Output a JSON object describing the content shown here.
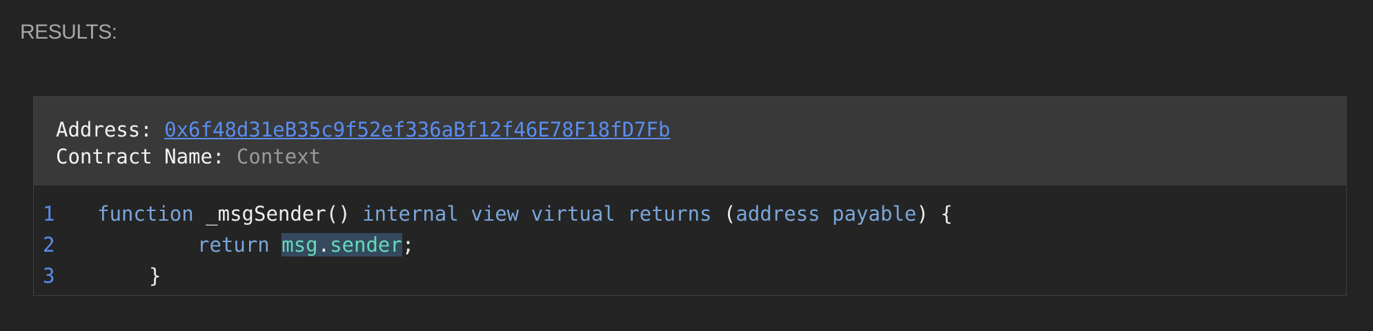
{
  "results": {
    "label": "RESULTS:"
  },
  "contract": {
    "address_label": "Address: ",
    "address_value": "0x6f48d31eB35c9f52ef336aBf12f46E78F18fD7Fb",
    "name_label": "Contract Name: ",
    "name_value": "Context"
  },
  "code": {
    "lines": [
      {
        "number": "1",
        "tokens": {
          "t0": "function",
          "t1": " _msgSender() ",
          "t2": "internal",
          "t3": " ",
          "t4": "view",
          "t5": " ",
          "t6": "virtual",
          "t7": " ",
          "t8": "returns",
          "t9": " (",
          "t10": "address",
          "t11": " ",
          "t12": "payable",
          "t13": ") {"
        }
      },
      {
        "number": "2",
        "tokens": {
          "t0": "return",
          "t1": " ",
          "t2": "msg",
          "t3": ".",
          "t4": "sender",
          "t5": ";"
        },
        "highlighted_text": "msg.sender"
      },
      {
        "number": "3",
        "tokens": {
          "t0": "}"
        }
      }
    ]
  },
  "colors": {
    "background": "#232323",
    "header_background": "#393939",
    "link": "#5b8def",
    "keyword": "#7aa6da",
    "highlight_background": "#34495e",
    "highlight_text": "#66d9b8"
  }
}
